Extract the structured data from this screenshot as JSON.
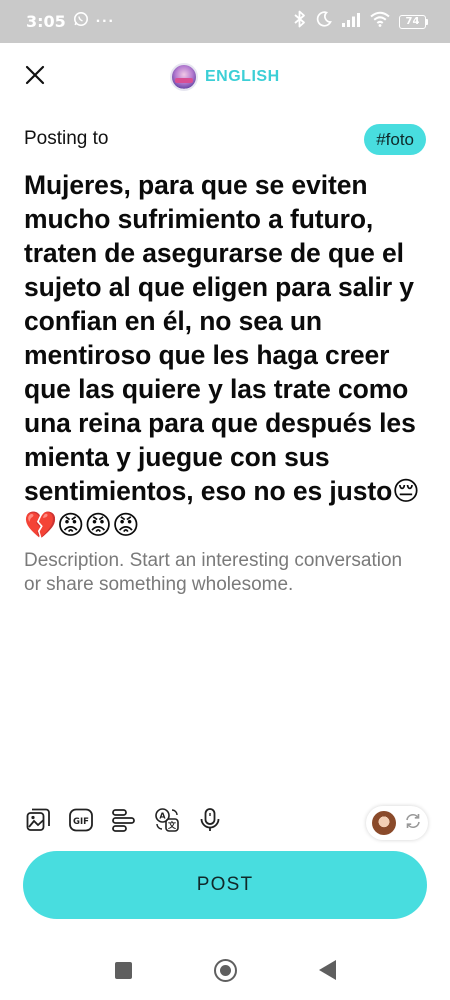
{
  "status_bar": {
    "time": "3:05",
    "battery": "74",
    "more": "···"
  },
  "header": {
    "community_name": "ENGLISH"
  },
  "posting": {
    "label": "Posting to",
    "hashtag": "#foto"
  },
  "post": {
    "title": "Mujeres, para que se eviten mucho sufrimiento a futuro, traten de asegurarse de que el sujeto al que eligen para salir y confian en él, no sea un mentiroso que les haga creer que las quiere y las trate como una reina para que después les mienta y juegue con sus sentimientos, eso no es justo😔💔😡😡😡",
    "description_placeholder": "Description. Start an interesting conversation or share something wholesome."
  },
  "actions": {
    "post_label": "POST"
  },
  "colors": {
    "accent": "#48dddf",
    "community_text": "#3ccfd6",
    "status_bar": "#c9c9c9"
  },
  "icons": [
    "close-icon",
    "image-icon",
    "gif-icon",
    "text-format-icon",
    "translate-icon",
    "microphone-icon",
    "switch-persona-icon"
  ]
}
